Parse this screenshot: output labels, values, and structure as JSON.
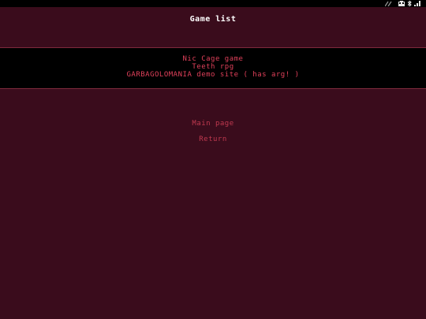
{
  "header": {
    "title": "Game list"
  },
  "status_bar": {
    "icons": [
      "signal-icon",
      "battery-icon",
      "bluetooth-icon"
    ]
  },
  "games": [
    {
      "label": "Nic Cage game"
    },
    {
      "label": "Teeth rpg"
    },
    {
      "label": "GARBAGOLOMANIA demo site ( has arg! )"
    }
  ],
  "nav": {
    "main_page": "Main page",
    "return": "Return"
  },
  "colors": {
    "background": "#3a0c1c",
    "panel": "#000000",
    "title": "#ffffff",
    "game_link": "#e0405a",
    "nav_link": "#c0394f",
    "divider": "#7e2a3c"
  }
}
